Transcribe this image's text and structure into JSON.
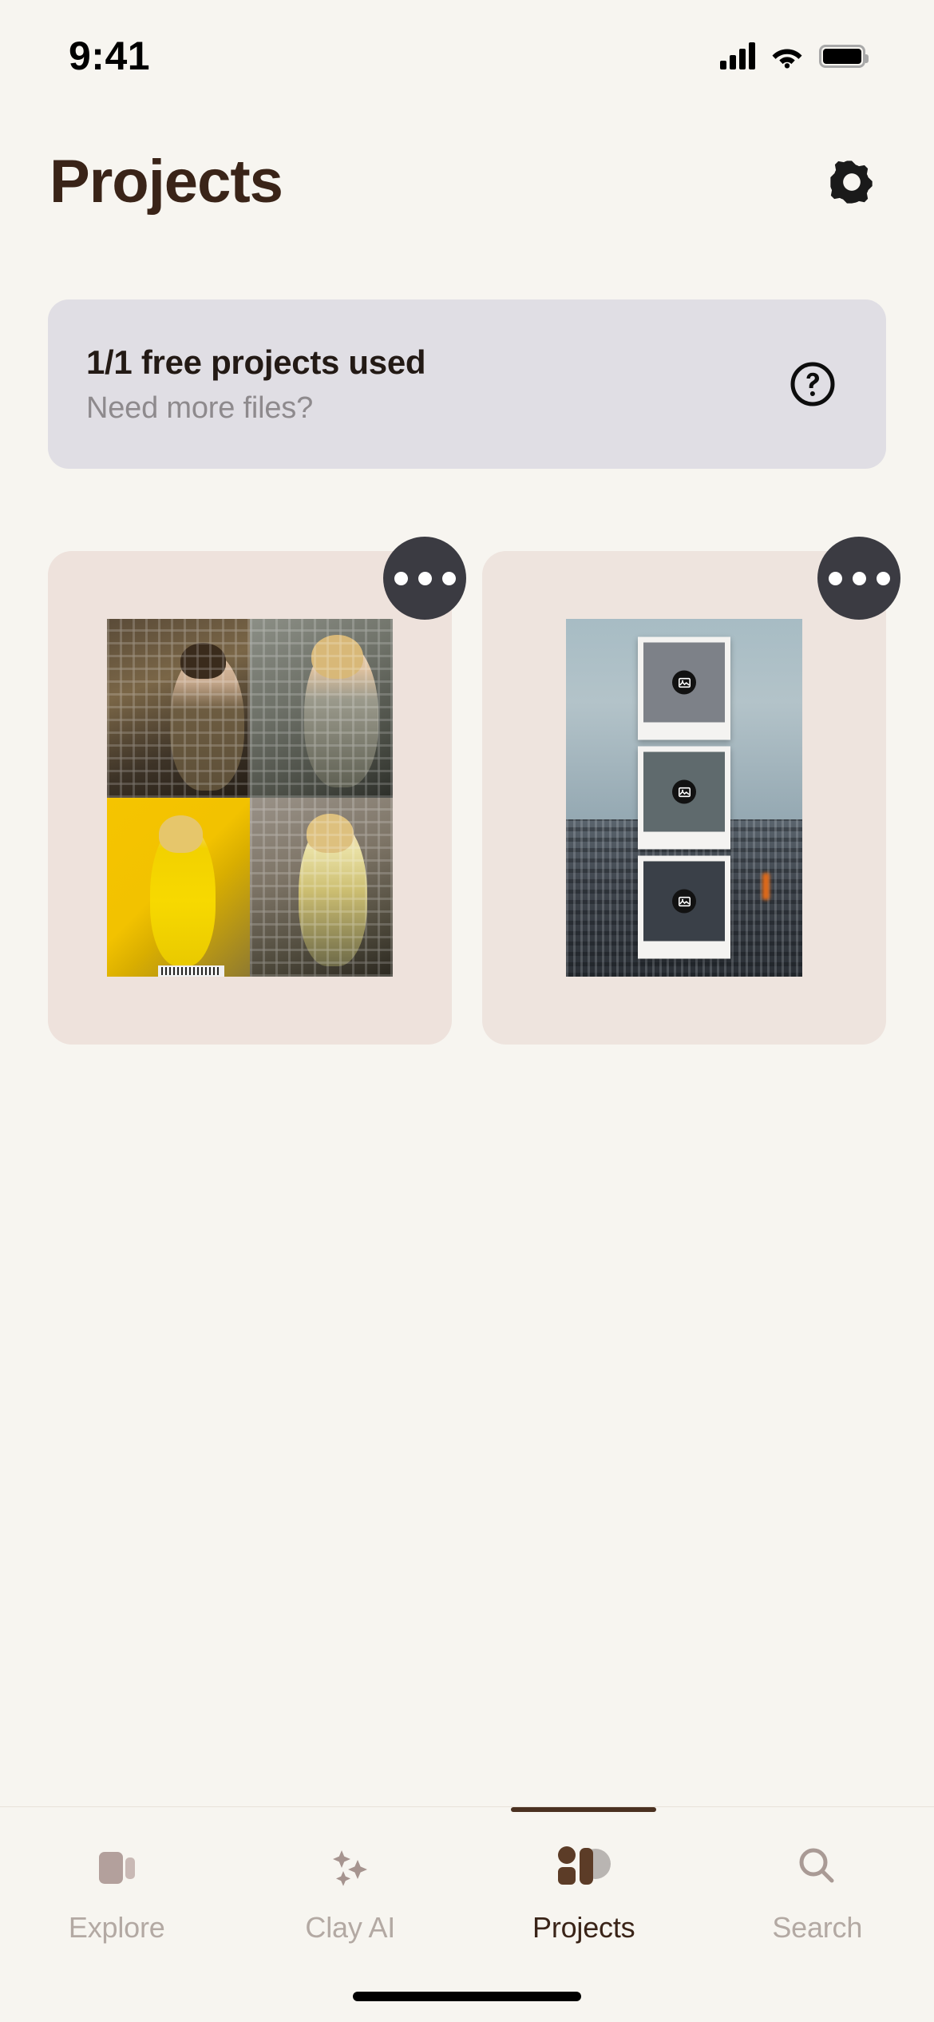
{
  "status_bar": {
    "time": "9:41",
    "signal_icon": "cellular-signal-icon",
    "wifi_icon": "wifi-icon",
    "battery_icon": "battery-icon"
  },
  "header": {
    "title": "Projects",
    "settings_icon": "gear-icon"
  },
  "banner": {
    "title": "1/1 free projects used",
    "subtitle": "Need more files?",
    "help_icon": "question-mark-circle-icon"
  },
  "projects": [
    {
      "name": "project-card-1",
      "thumbnail_type": "photo-collage-2x2",
      "menu_icon": "more-options-icon",
      "tiles": [
        "plaid-shirt-brunette",
        "plaid-crop-top-blonde",
        "yellow-tracksuit",
        "yellow-plaid-outfit"
      ]
    },
    {
      "name": "project-card-2",
      "thumbnail_type": "city-polaroid-stack",
      "menu_icon": "more-options-icon",
      "tiles": [
        "broken-image-placeholder",
        "broken-image-placeholder",
        "broken-image-placeholder"
      ]
    }
  ],
  "tabbar": {
    "items": [
      {
        "label": "Explore",
        "icon": "cards-icon",
        "active": false
      },
      {
        "label": "Clay AI",
        "icon": "sparkles-icon",
        "active": false
      },
      {
        "label": "Projects",
        "icon": "shapes-icon",
        "active": true
      },
      {
        "label": "Search",
        "icon": "search-icon",
        "active": false
      }
    ]
  },
  "colors": {
    "background": "#f7f5f0",
    "text_primary": "#3a2418",
    "text_muted": "#b3a9a3",
    "banner_bg": "#e0dee4",
    "card_bg": "#eee2dc",
    "menu_button_bg": "#3b3b42",
    "accent": "#4a3020"
  }
}
